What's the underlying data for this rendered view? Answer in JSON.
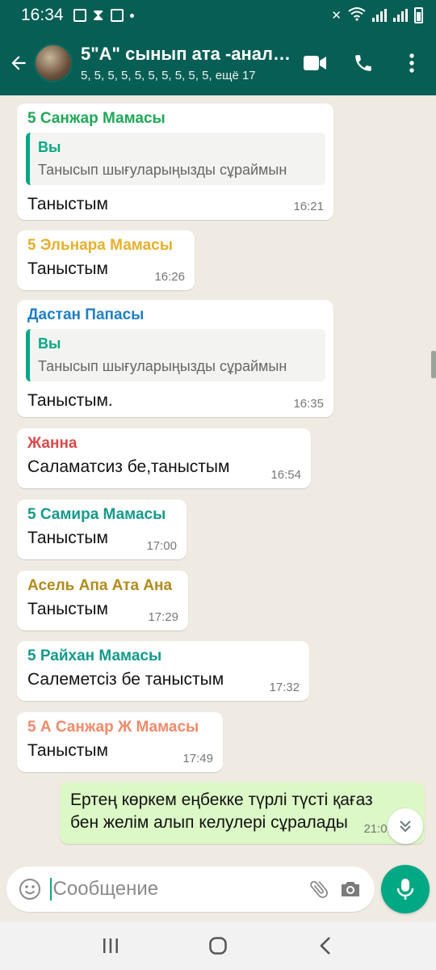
{
  "status": {
    "time": "16:34"
  },
  "header": {
    "title": "5\"А\" сынып ата -анала...",
    "subtitle": "5, 5, 5, 5, 5, 5, 5, 5, 5, 5, ещё 17"
  },
  "colors": {
    "header": "#075e54",
    "accent": "#00a884",
    "outgoing_bubble": "#dcf8c6",
    "chat_bg": "#efeae2"
  },
  "messages": [
    {
      "sender": "5 Санжар Мамасы",
      "sender_color": "#1fa855",
      "quote": {
        "name": "Вы",
        "text": "Танысып шығуларыңызды сұраймын"
      },
      "text": "Таныстым",
      "time": "16:21"
    },
    {
      "sender": "5 Эльнара Мамасы",
      "sender_color": "#e6b02b",
      "text": "Таныстым",
      "time": "16:26"
    },
    {
      "sender": "Дастан Папасы",
      "sender_color": "#1f7fc4",
      "quote": {
        "name": "Вы",
        "text": "Танысып шығуларыңызды сұраймын"
      },
      "text": "Таныстым.",
      "time": "16:35"
    },
    {
      "sender": "Жанна",
      "sender_color": "#d94a4a",
      "text": "Саламатсиз бе,таныстым",
      "time": "16:54"
    },
    {
      "sender": "5 Самира Мамасы",
      "sender_color": "#159a8a",
      "text": "Таныстым",
      "time": "17:00"
    },
    {
      "sender": "Асель Апа Ата Ана",
      "sender_color": "#b28a1c",
      "text": "Таныстым",
      "time": "17:29"
    },
    {
      "sender": "5 Райхан Мамасы",
      "sender_color": "#129a8c",
      "text": "Салеметсіз бе  таныстым",
      "time": "17:32"
    },
    {
      "sender": "5 А Санжар Ж Мамасы",
      "sender_color": "#ef8a6a",
      "text": "Таныстым",
      "time": "17:49"
    }
  ],
  "outgoing": {
    "text": "Ертең көркем еңбекке түрлі түсті қағаз бен желім алып келулері сұралады",
    "time": "21:01",
    "status_icon": "double-check-icon"
  },
  "input": {
    "placeholder": "Сообщение"
  },
  "icons": [
    "back-arrow-icon",
    "video-call-icon",
    "phone-icon",
    "more-vert-icon",
    "emoji-icon",
    "attach-icon",
    "camera-icon",
    "mic-icon",
    "chevron-double-down-icon",
    "recents-icon",
    "home-icon",
    "back-icon"
  ]
}
